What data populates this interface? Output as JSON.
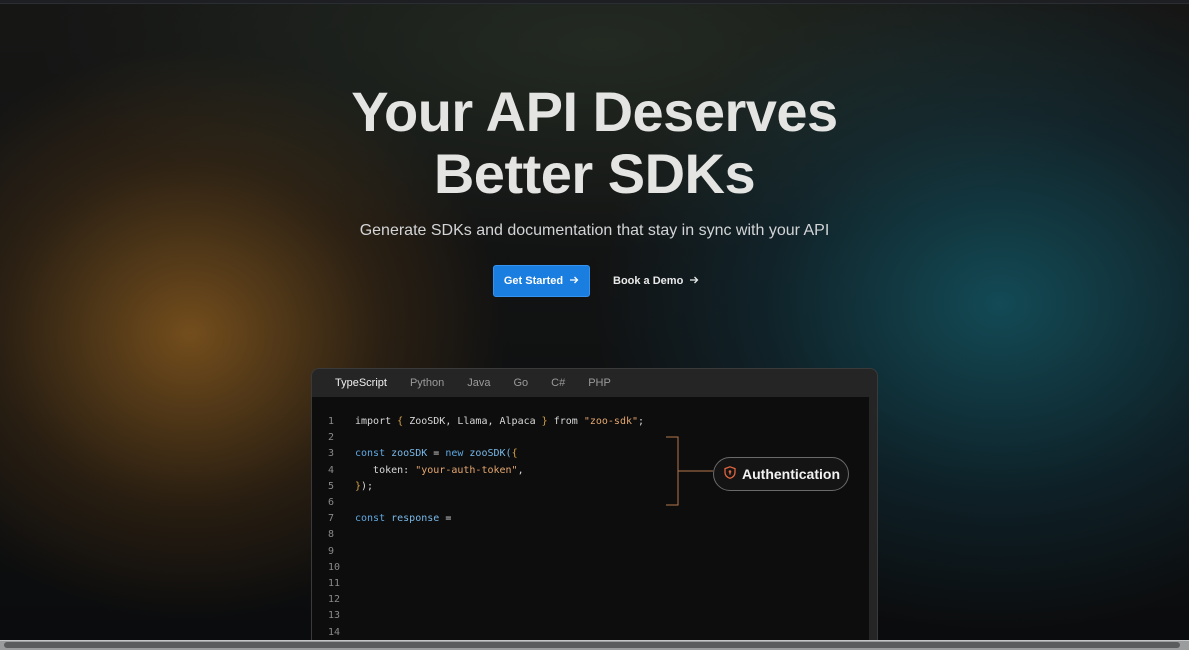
{
  "hero": {
    "title_line1": "Your API Deserves",
    "title_line2": "Better SDKs",
    "subtitle": "Generate SDKs and documentation that stay in sync with your API",
    "primary_cta": "Get Started",
    "secondary_cta": "Book a Demo"
  },
  "editor": {
    "tabs": [
      {
        "label": "TypeScript",
        "active": true
      },
      {
        "label": "Python",
        "active": false
      },
      {
        "label": "Java",
        "active": false
      },
      {
        "label": "Go",
        "active": false
      },
      {
        "label": "C#",
        "active": false
      },
      {
        "label": "PHP",
        "active": false
      }
    ],
    "lines": [
      {
        "n": "1",
        "tokens": [
          [
            "import ",
            "id"
          ],
          [
            "{",
            "br"
          ],
          [
            " ZooSDK, Llama, Alpaca ",
            "id"
          ],
          [
            "}",
            "br"
          ],
          [
            " from ",
            "id"
          ],
          [
            "\"zoo-sdk\"",
            "str"
          ],
          [
            ";",
            "id"
          ]
        ]
      },
      {
        "n": "2",
        "tokens": []
      },
      {
        "n": "3",
        "tokens": [
          [
            "const ",
            "kw"
          ],
          [
            "zooSDK",
            "fn"
          ],
          [
            " = ",
            "id"
          ],
          [
            "new ",
            "kw"
          ],
          [
            "zooSDK(",
            "fn"
          ],
          [
            "{",
            "br"
          ]
        ]
      },
      {
        "n": "4",
        "tokens": [
          [
            "   token: ",
            "id"
          ],
          [
            "\"your-auth-token\"",
            "str"
          ],
          [
            ",",
            "id"
          ]
        ]
      },
      {
        "n": "5",
        "tokens": [
          [
            "}",
            "br"
          ],
          [
            ");",
            "id"
          ]
        ]
      },
      {
        "n": "6",
        "tokens": []
      },
      {
        "n": "7",
        "tokens": [
          [
            "const ",
            "kw"
          ],
          [
            "response",
            "fn"
          ],
          [
            " =",
            "id"
          ]
        ]
      },
      {
        "n": "8",
        "tokens": []
      },
      {
        "n": "9",
        "tokens": []
      },
      {
        "n": "10",
        "tokens": []
      },
      {
        "n": "11",
        "tokens": []
      },
      {
        "n": "12",
        "tokens": []
      },
      {
        "n": "13",
        "tokens": []
      },
      {
        "n": "14",
        "tokens": []
      }
    ],
    "annotation": {
      "label": "Authentication",
      "icon": "shield-icon"
    }
  },
  "colors": {
    "primary_button": "#1a7de0",
    "keyword": "#5fa7e0",
    "string": "#e5a76f",
    "bracket": "#d7a24a",
    "annotation_line": "#b5774a"
  }
}
